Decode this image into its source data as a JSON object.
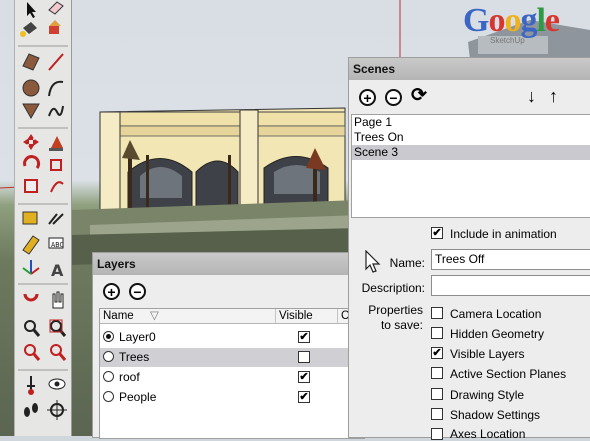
{
  "branding": {
    "letters": [
      "G",
      "o",
      "o",
      "g",
      "l",
      "e"
    ],
    "colors": [
      "#3b66c4",
      "#d6362f",
      "#f0b21c",
      "#3b66c4",
      "#2f9a46",
      "#d6362f"
    ],
    "mark": "SketchUp"
  },
  "toolbar": {
    "icons": [
      "select-arrow-icon",
      "eraser-icon",
      "paint-bucket-icon",
      "push-pull-icon",
      "rectangle-icon",
      "pencil-line-icon",
      "circle-icon",
      "arc-icon",
      "polygon-icon",
      "freehand-icon",
      "move-icon",
      "rotate-icon",
      "scale-icon",
      "follow-me-icon",
      "offset-icon",
      "orbit-icon",
      "pan-icon",
      "zoom-icon",
      "zoom-window-icon",
      "zoom-extents-icon",
      "tape-measure-icon",
      "protractor-icon",
      "dimension-icon",
      "text-icon",
      "axes-icon",
      "3d-text-icon",
      "section-plane-icon",
      "walk-icon",
      "position-camera-icon",
      "look-around-icon",
      "footprints-icon",
      "walkthrough-icon"
    ]
  },
  "layers": {
    "title": "Layers",
    "add_symbol": "+",
    "remove_symbol": "−",
    "columns": {
      "name": "Name",
      "visible": "Visible",
      "color": "Co"
    },
    "rows": [
      {
        "name": "Layer0",
        "active": true,
        "visible": true,
        "color": "#d64a63"
      },
      {
        "name": "Trees",
        "active": false,
        "visible": false,
        "color": "#d76a4a"
      },
      {
        "name": "roof",
        "active": false,
        "visible": true,
        "color": "#3fa9a0"
      },
      {
        "name": "People",
        "active": false,
        "visible": true,
        "color": "#8a3fbf"
      }
    ],
    "checkmark": "✔"
  },
  "scenes": {
    "title": "Scenes",
    "add_symbol": "+",
    "remove_symbol": "−",
    "update_symbol": "⟳",
    "move_down_symbol": "↓",
    "move_up_symbol": "↑",
    "items": [
      {
        "name": "Page 1",
        "selected": false
      },
      {
        "name": "Trees On",
        "selected": false
      },
      {
        "name": "Scene 3",
        "selected": true
      }
    ],
    "include_animation_label": "Include in animation",
    "include_animation_checked": true,
    "name_label": "Name:",
    "name_value": "Trees Off",
    "description_label": "Description:",
    "description_value": "",
    "properties_label_line1": "Properties",
    "properties_label_line2": "to save:",
    "properties": [
      {
        "label": "Camera Location",
        "checked": false
      },
      {
        "label": "Hidden Geometry",
        "checked": false
      },
      {
        "label": "Visible Layers",
        "checked": true
      },
      {
        "label": "Active Section Planes",
        "checked": false
      },
      {
        "label": "Drawing Style",
        "checked": false
      },
      {
        "label": "Shadow Settings",
        "checked": false
      },
      {
        "label": "Axes Location",
        "checked": false
      }
    ]
  }
}
